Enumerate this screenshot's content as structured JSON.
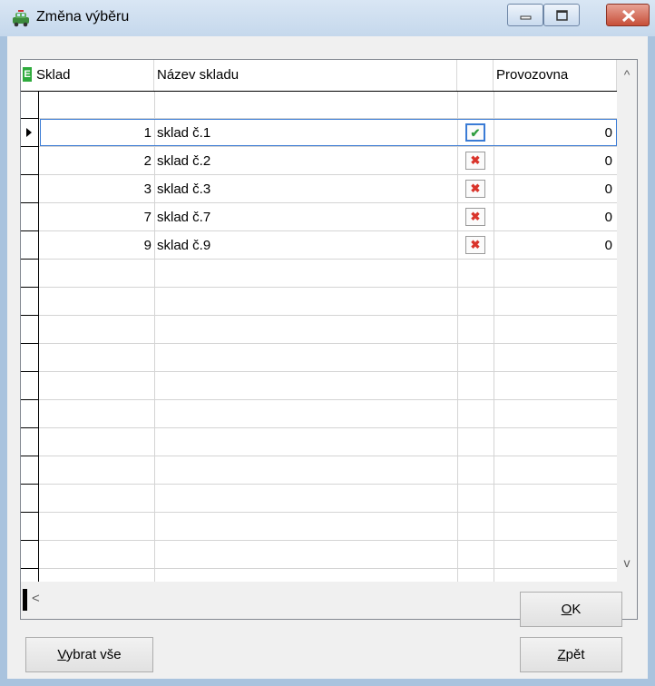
{
  "window": {
    "title": "Změna výběru",
    "icons": [
      "app-car-icon",
      "minimize-icon",
      "maximize-icon",
      "close-icon"
    ]
  },
  "grid": {
    "header_marker": "E",
    "columns": [
      "Sklad",
      "Název skladu",
      "",
      "Provozovna"
    ],
    "rows": [
      {
        "sklad": "1",
        "nazev": "sklad č.1",
        "checked": true,
        "provozovna": "0"
      },
      {
        "sklad": "2",
        "nazev": "sklad č.2",
        "checked": false,
        "provozovna": "0"
      },
      {
        "sklad": "3",
        "nazev": "sklad č.3",
        "checked": false,
        "provozovna": "0"
      },
      {
        "sklad": "7",
        "nazev": "sklad č.7",
        "checked": false,
        "provozovna": "0"
      },
      {
        "sklad": "9",
        "nazev": "sklad č.9",
        "checked": false,
        "provozovna": "0"
      }
    ],
    "check_glyph": "✔",
    "cross_glyph": "✖",
    "scroll": {
      "up": "^",
      "down": "v",
      "left": "<",
      "right": ">"
    }
  },
  "buttons": {
    "ok_accel": "O",
    "ok_rest": "K",
    "back_accel": "Z",
    "back_rest": "pět",
    "select_all_accel": "V",
    "select_all_rest": "ybrat vše"
  },
  "colors": {
    "check": "#2f9d3f",
    "cross": "#d9342b",
    "selection": "#3a7bd5"
  }
}
